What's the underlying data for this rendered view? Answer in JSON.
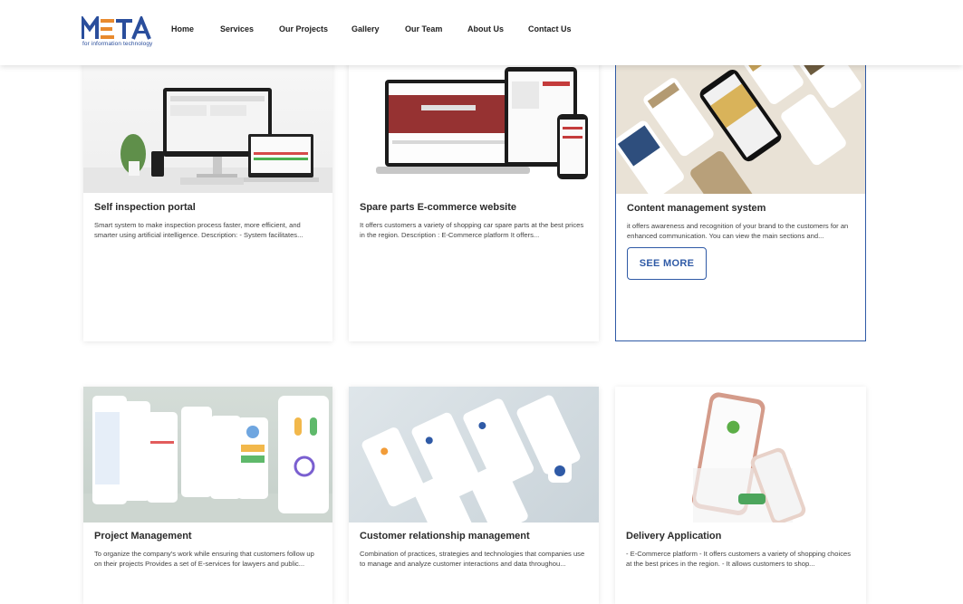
{
  "header": {
    "logo_text": "META",
    "logo_tagline": "for information technology",
    "nav": [
      "Home",
      "Services",
      "Our Projects",
      "Gallery",
      "Our Team",
      "About Us",
      "Contact Us"
    ]
  },
  "projects": [
    {
      "title": "Self inspection portal",
      "description": "Smart system to make inspection process faster, more efficient, and smarter using artificial intelligence. Description: - System facilitates..."
    },
    {
      "title": "Spare parts E-commerce website",
      "description": "It offers customers a variety of shopping car spare parts at the best prices in the region.  Description : E-Commerce platform It offers..."
    },
    {
      "title": "Content management system",
      "description": " it offers awareness and recognition of your brand to the customers for an enhanced communication.   You can view the main sections and...",
      "button": "SEE MORE"
    },
    {
      "title": "Project Management",
      "description": "To organize the company's work while ensuring that customers follow up on their projects Provides a set of E-services for lawyers and public..."
    },
    {
      "title": "Customer relationship management",
      "description": "Combination of practices, strategies and technologies that companies use to manage and analyze customer interactions and data throughou..."
    },
    {
      "title": "Delivery Application",
      "description": "- E-Commerce platform - It offers customers a variety of shopping choices at the best prices in the region.   - It allows customers to shop..."
    }
  ],
  "colors": {
    "brand": "#2f5aa6",
    "logo_orange": "#e88a2e"
  }
}
